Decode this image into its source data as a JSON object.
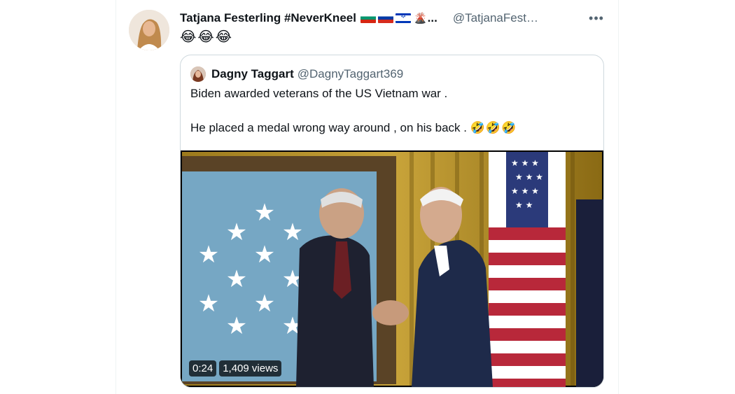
{
  "tweet": {
    "author_name": "Tatjana Festerling #NeverKneel",
    "author_ellipsis": "...",
    "handle": "@TatjanaFest…",
    "more_glyph": "•••",
    "text": "😂😂😂",
    "flags": [
      "flag-bulgaria",
      "flag-russia",
      "flag-israel"
    ],
    "volcano_icon": "🌋"
  },
  "quote": {
    "author_name": "Dagny Taggart",
    "handle": "@DagnyTaggart369",
    "line1": "Biden awarded veterans of the US Vietnam war .",
    "line2": "He placed a medal wrong way around , on his back .",
    "line2_emoji": "🤣🤣🤣"
  },
  "video": {
    "duration": "0:24",
    "views": "1,409 views"
  },
  "colors": {
    "text": "#0f1419",
    "muted": "#536471",
    "border": "#cfd9de"
  }
}
